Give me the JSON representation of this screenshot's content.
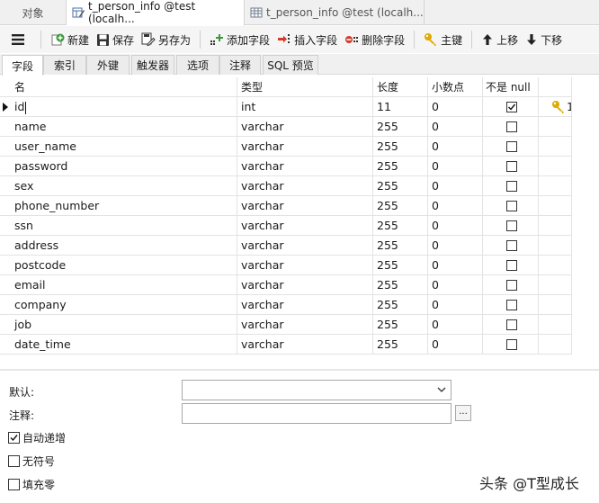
{
  "doc_tabs": {
    "objects": "对象",
    "design": "t_person_info @test (localh...",
    "data": "t_person_info @test (localh..."
  },
  "toolbar": {
    "new": "新建",
    "save": "保存",
    "save_as": "另存为",
    "add_field": "添加字段",
    "insert_field": "插入字段",
    "delete_field": "删除字段",
    "primary_key": "主键",
    "move_up": "上移",
    "move_down": "下移"
  },
  "sub_tabs": [
    "字段",
    "索引",
    "外键",
    "触发器",
    "选项",
    "注释",
    "SQL 预览"
  ],
  "columns": {
    "name": "名",
    "type": "类型",
    "length": "长度",
    "decimals": "小数点",
    "not_null": "不是 null"
  },
  "fields": [
    {
      "name": "id",
      "type": "int",
      "length": "11",
      "decimals": "0",
      "not_null": true,
      "key": "1"
    },
    {
      "name": "name",
      "type": "varchar",
      "length": "255",
      "decimals": "0",
      "not_null": false,
      "key": ""
    },
    {
      "name": "user_name",
      "type": "varchar",
      "length": "255",
      "decimals": "0",
      "not_null": false,
      "key": ""
    },
    {
      "name": "password",
      "type": "varchar",
      "length": "255",
      "decimals": "0",
      "not_null": false,
      "key": ""
    },
    {
      "name": "sex",
      "type": "varchar",
      "length": "255",
      "decimals": "0",
      "not_null": false,
      "key": ""
    },
    {
      "name": "phone_number",
      "type": "varchar",
      "length": "255",
      "decimals": "0",
      "not_null": false,
      "key": ""
    },
    {
      "name": "ssn",
      "type": "varchar",
      "length": "255",
      "decimals": "0",
      "not_null": false,
      "key": ""
    },
    {
      "name": "address",
      "type": "varchar",
      "length": "255",
      "decimals": "0",
      "not_null": false,
      "key": ""
    },
    {
      "name": "postcode",
      "type": "varchar",
      "length": "255",
      "decimals": "0",
      "not_null": false,
      "key": ""
    },
    {
      "name": "email",
      "type": "varchar",
      "length": "255",
      "decimals": "0",
      "not_null": false,
      "key": ""
    },
    {
      "name": "company",
      "type": "varchar",
      "length": "255",
      "decimals": "0",
      "not_null": false,
      "key": ""
    },
    {
      "name": "job",
      "type": "varchar",
      "length": "255",
      "decimals": "0",
      "not_null": false,
      "key": ""
    },
    {
      "name": "date_time",
      "type": "varchar",
      "length": "255",
      "decimals": "0",
      "not_null": false,
      "key": ""
    }
  ],
  "props": {
    "default_label": "默认:",
    "default_value": "",
    "comment_label": "注释:",
    "comment_value": "",
    "ellipsis": "...",
    "auto_increment": {
      "label": "自动递增",
      "checked": true
    },
    "unsigned": {
      "label": "无符号",
      "checked": false
    },
    "zerofill": {
      "label": "填充零",
      "checked": false
    }
  },
  "watermark": "头条 @T型成长",
  "colors": {
    "key_gold": "#e0a800",
    "add_green": "#3a9a3a",
    "delete_red": "#d33a2c"
  }
}
